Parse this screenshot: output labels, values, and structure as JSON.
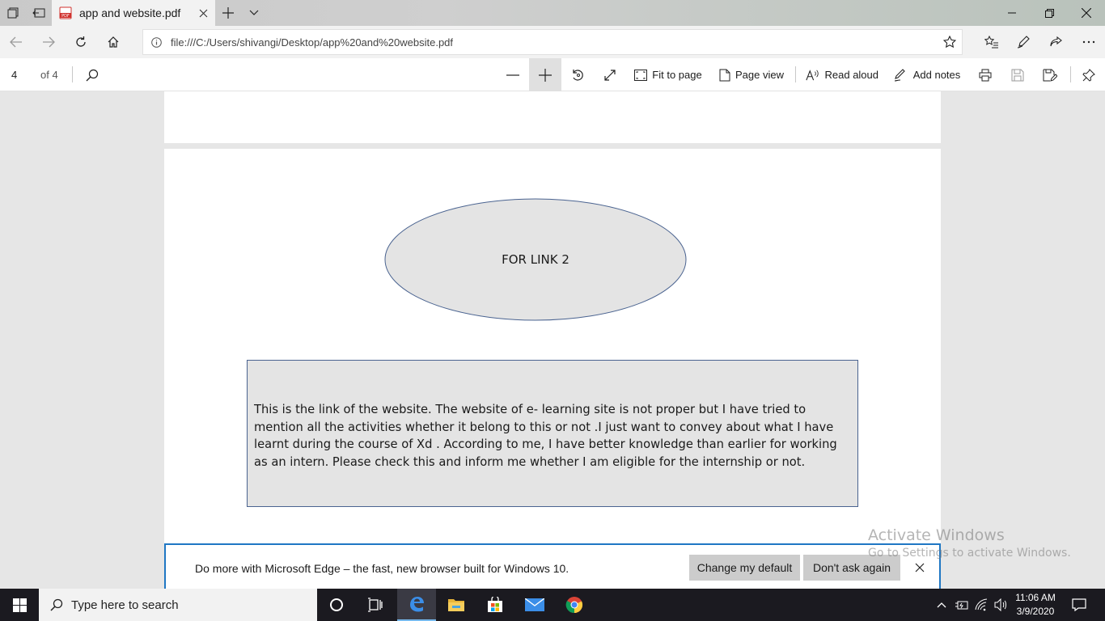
{
  "browser": {
    "tab_title": "app and website.pdf",
    "url": "file:///C:/Users/shivangi/Desktop/app%20and%20website.pdf"
  },
  "pdf_toolbar": {
    "page_number": "4",
    "page_total": "of 4",
    "fit_to_page": "Fit to page",
    "page_view": "Page view",
    "read_aloud": "Read aloud",
    "add_notes": "Add notes"
  },
  "document": {
    "ellipse_label": "FOR LINK 2",
    "body_text": "This is the link of the website.  The website of e- learning site is not proper but I have tried to mention all the activities whether it belong to this or not .I just want to convey about what I have learnt during the course of Xd . According to me, I have better knowledge than earlier for working as an intern. Please check this and inform me whether I am eligible for the internship or not."
  },
  "watermark": {
    "title": "Activate Windows",
    "subtitle": "Go to Settings to activate Windows."
  },
  "notification": {
    "message": "Do more with Microsoft Edge – the fast, new browser built for Windows 10.",
    "change_default": "Change my default",
    "dont_ask": "Don't ask again"
  },
  "taskbar": {
    "search_placeholder": "Type here to search",
    "time": "11:06 AM",
    "date": "3/9/2020"
  },
  "colors": {
    "accent": "#1f77c4",
    "page_bg": "#e6e6e6",
    "ellipse_fill": "#e4e4e4",
    "ellipse_stroke": "#4a6390"
  }
}
